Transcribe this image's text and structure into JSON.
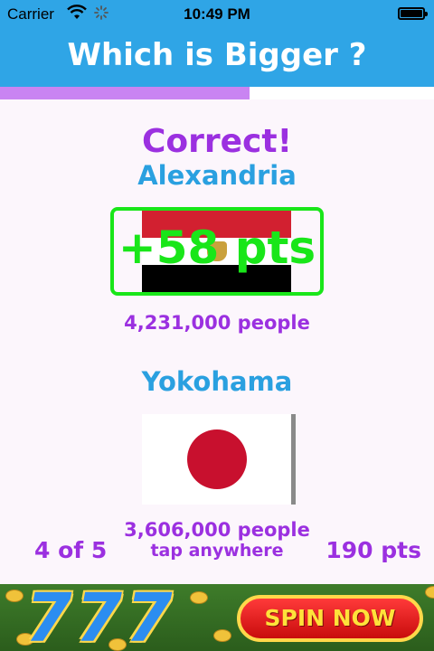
{
  "status_bar": {
    "carrier": "Carrier",
    "time": "10:49 PM"
  },
  "header": {
    "title": "Which is Bigger ?"
  },
  "progress": {
    "fraction": 0.575,
    "color": "#c984f2"
  },
  "result": {
    "message": "Correct!",
    "points_awarded": "+58 pts"
  },
  "city_a": {
    "name": "Alexandria",
    "flag": "egypt-flag",
    "population": "4,231,000 people"
  },
  "city_b": {
    "name": "Yokohama",
    "flag": "japan-flag",
    "population": "3,606,000 people"
  },
  "footer": {
    "round": "4 of 5",
    "hint": "tap anywhere",
    "score": "190 pts"
  },
  "ad": {
    "slot_symbols": "777",
    "cta": "SPIN NOW"
  },
  "colors": {
    "brand_blue": "#2fa5e6",
    "purple": "#9b30e0",
    "city_blue": "#2aa0e0",
    "success_green": "#19e619"
  }
}
